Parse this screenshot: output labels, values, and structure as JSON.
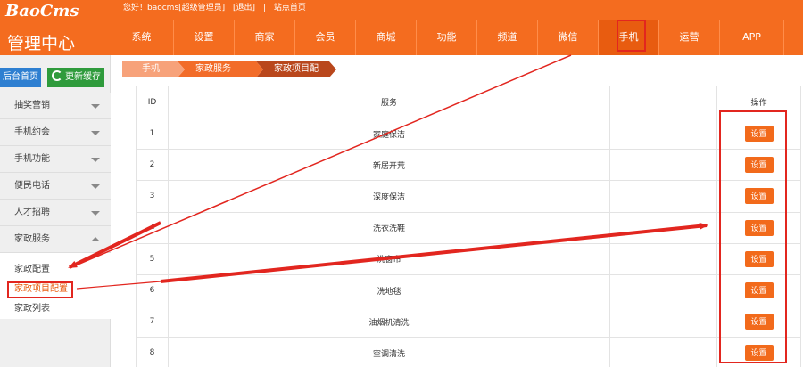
{
  "header": {
    "logo_text": "BaoCms",
    "logo_title": "管理中心",
    "greeting": "您好！baocms[超级管理员]",
    "logout": "[退出]",
    "site_home": "站点首页",
    "nav": [
      {
        "label": "系统",
        "width": 68
      },
      {
        "label": "设置",
        "width": 68
      },
      {
        "label": "商家",
        "width": 68
      },
      {
        "label": "会员",
        "width": 68
      },
      {
        "label": "商城",
        "width": 68
      },
      {
        "label": "功能",
        "width": 68
      },
      {
        "label": "频道",
        "width": 68
      },
      {
        "label": "微信",
        "width": 68
      },
      {
        "label": "手机",
        "width": 68
      },
      {
        "label": "运营",
        "width": 68
      },
      {
        "label": "APP",
        "width": 68
      }
    ]
  },
  "sidebar": {
    "home_button": "后台首页",
    "cache_button": "更新缓存",
    "menu": [
      "抽奖营销",
      "手机约会",
      "手机功能",
      "便民电话",
      "人才招聘",
      "家政服务"
    ],
    "submenu": [
      "家政配置",
      "家政项目配置",
      "家政列表"
    ]
  },
  "breadcrumb": [
    "手机",
    "家政服务",
    "家政项目配置"
  ],
  "table": {
    "headers": {
      "id": "ID",
      "service": "服务",
      "operation": "操作"
    },
    "button_label": "设置",
    "rows": [
      {
        "id": "1",
        "service": "家庭保洁"
      },
      {
        "id": "2",
        "service": "新居开荒"
      },
      {
        "id": "3",
        "service": "深度保洁"
      },
      {
        "id": "4",
        "service": "洗衣洗鞋"
      },
      {
        "id": "5",
        "service": "洗窗帘"
      },
      {
        "id": "6",
        "service": "洗地毯"
      },
      {
        "id": "7",
        "service": "油烟机清洗"
      },
      {
        "id": "8",
        "service": "空调清洗"
      }
    ]
  },
  "colors": {
    "header_orange": "#f46c1f",
    "button_orange": "#f26a1b",
    "annotation_red": "#e2261f"
  }
}
